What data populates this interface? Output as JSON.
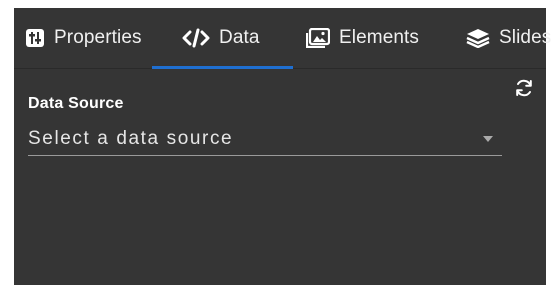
{
  "tabs": [
    {
      "label": "Properties",
      "icon": "sliders-icon"
    },
    {
      "label": "Data",
      "icon": "code-icon"
    },
    {
      "label": "Elements",
      "icon": "image-icon"
    },
    {
      "label": "Slides",
      "icon": "layers-icon"
    }
  ],
  "active_tab": "Data",
  "data_source": {
    "label": "Data Source",
    "placeholder": "Select a data source",
    "refresh_icon": "refresh-icon"
  },
  "colors": {
    "panel_bg": "#353535",
    "accent": "#1f6fd1",
    "text": "#ffffff"
  }
}
